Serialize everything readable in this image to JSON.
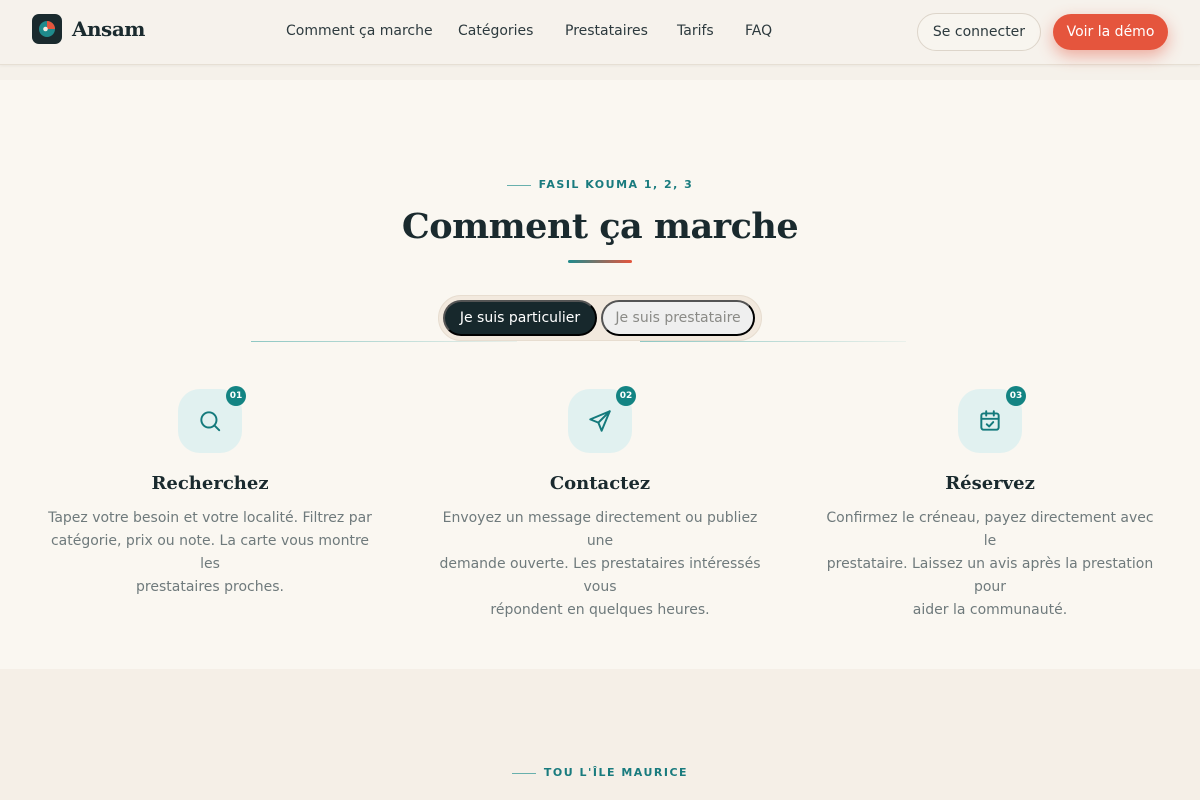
{
  "brand": {
    "name": "Ansam"
  },
  "nav": {
    "links": [
      "Comment ça marche",
      "Catégories",
      "Prestataires",
      "Tarifs",
      "FAQ"
    ],
    "login_label": "Se connecter",
    "demo_label": "Voir la démo"
  },
  "how": {
    "eyebrow": "FASIL KOUMA 1, 2, 3",
    "title": "Comment ça marche",
    "toggle": {
      "active": "Je suis particulier",
      "inactive": "Je suis prestataire"
    },
    "steps": [
      {
        "number": "01",
        "icon": "search-icon",
        "title": "Recherchez",
        "desc_lines": [
          "Tapez votre besoin et votre localité. Filtrez par",
          "catégorie, prix ou note. La carte vous montre les",
          "prestataires proches."
        ]
      },
      {
        "number": "02",
        "icon": "send-icon",
        "title": "Contactez",
        "desc_lines": [
          "Envoyez un message directement ou publiez une",
          "demande ouverte. Les prestataires intéressés vous",
          "répondent en quelques heures."
        ]
      },
      {
        "number": "03",
        "icon": "calendar-check-icon",
        "title": "Réservez",
        "desc_lines": [
          "Confirmez le créneau, payez directement avec le",
          "prestataire. Laissez un avis après la prestation pour",
          "aider la communauté."
        ]
      }
    ]
  },
  "next_section": {
    "eyebrow": "TOU L'ÎLE MAURICE"
  },
  "colors": {
    "accent": "#138483",
    "cta": "#e5553d",
    "dark": "#17282c"
  }
}
